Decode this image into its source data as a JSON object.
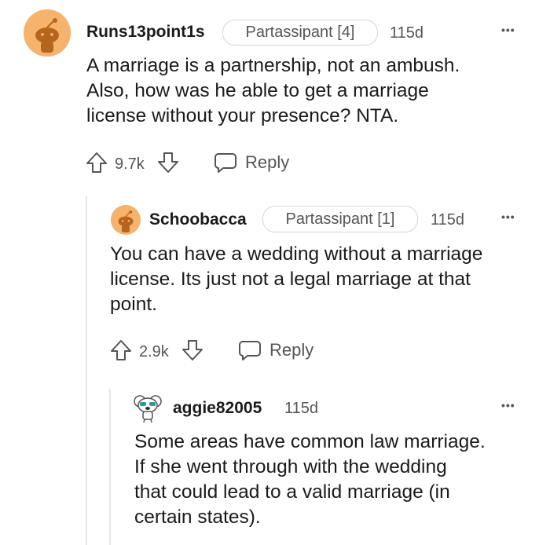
{
  "comments": [
    {
      "username": "Runs13point1s",
      "flair": "Partassipant [4]",
      "age": "115d",
      "more": "•••",
      "body": [
        "A marriage is a partnership, not an ambush.",
        "Also, how was he able to get a marriage",
        "license without your presence? NTA."
      ],
      "votes": "9.7k",
      "reply_label": "Reply"
    },
    {
      "username": "Schoobacca",
      "flair": "Partassipant [1]",
      "age": "115d",
      "more": "•••",
      "body": [
        "You can have a wedding without a marriage",
        "license. Its just not a legal marriage at that",
        "point."
      ],
      "votes": "2.9k",
      "reply_label": "Reply"
    },
    {
      "username": "aggie82005",
      "age": "115d",
      "more": "•••",
      "body": [
        "Some areas have common law marriage.",
        "If she went through with the wedding",
        "that could lead to a valid marriage (in",
        "certain states)."
      ]
    }
  ],
  "colors": {
    "avatar_orange": "#f5b36d",
    "text": "#1a1a1b",
    "muted": "#555555"
  }
}
